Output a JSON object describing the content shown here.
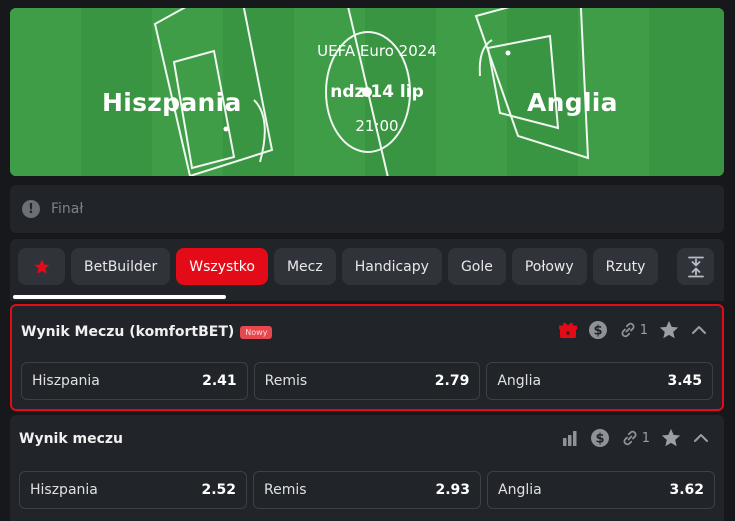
{
  "event": {
    "home_team": "Hiszpania",
    "away_team": "Anglia",
    "competition": "UEFA Euro 2024",
    "date": "ndz 14 lip",
    "time": "21:00",
    "stage": "Finał"
  },
  "tabs": [
    {
      "label": "BetBuilder"
    },
    {
      "label": "Wszystko",
      "active": true
    },
    {
      "label": "Mecz"
    },
    {
      "label": "Handicapy"
    },
    {
      "label": "Gole"
    },
    {
      "label": "Połowy"
    },
    {
      "label": "Rzuty"
    }
  ],
  "tab_icons": {
    "favorites": "star-icon",
    "expand": "expand-collapse-icon"
  },
  "markets": [
    {
      "title": "Wynik Meczu (komfortBET)",
      "badge": "Nowy",
      "link_count": "1",
      "icons": [
        "gift-icon",
        "dollar-icon",
        "link-icon",
        "star-icon",
        "chevron-up-icon"
      ],
      "selections": [
        {
          "name": "Hiszpania",
          "odd": "2.41"
        },
        {
          "name": "Remis",
          "odd": "2.79"
        },
        {
          "name": "Anglia",
          "odd": "3.45"
        }
      ]
    },
    {
      "title": "Wynik meczu",
      "link_count": "1",
      "icons": [
        "stats-icon",
        "dollar-icon",
        "link-icon",
        "star-icon",
        "chevron-up-icon"
      ],
      "selections": [
        {
          "name": "Hiszpania",
          "odd": "2.52"
        },
        {
          "name": "Remis",
          "odd": "2.93"
        },
        {
          "name": "Anglia",
          "odd": "3.62"
        }
      ]
    }
  ],
  "colors": {
    "accent": "#e30b17",
    "pitch": "#3c9a44",
    "panel": "#212429",
    "background": "#16181c"
  }
}
